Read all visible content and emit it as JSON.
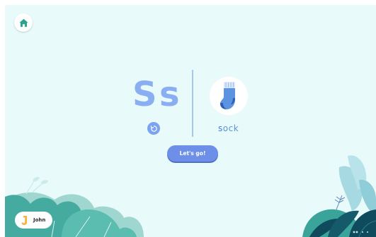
{
  "letter": {
    "uppercase": "S",
    "lowercase": "s"
  },
  "word": {
    "first_letter": "s",
    "rest": "ock",
    "image_icon": "sock-icon"
  },
  "actions": {
    "go_label": "Let's go!",
    "replay_icon": "replay-icon",
    "home_icon": "home-icon"
  },
  "user": {
    "name": "John",
    "avatar_icon": "letter-j-avatar-icon"
  },
  "colors": {
    "background": "#e9fafa",
    "letter": "#8aaef2",
    "button": "#6d8fe8",
    "home": "#2fa28e",
    "foliage_teal": "#49b3a8",
    "foliage_dark": "#0f4b5c"
  }
}
